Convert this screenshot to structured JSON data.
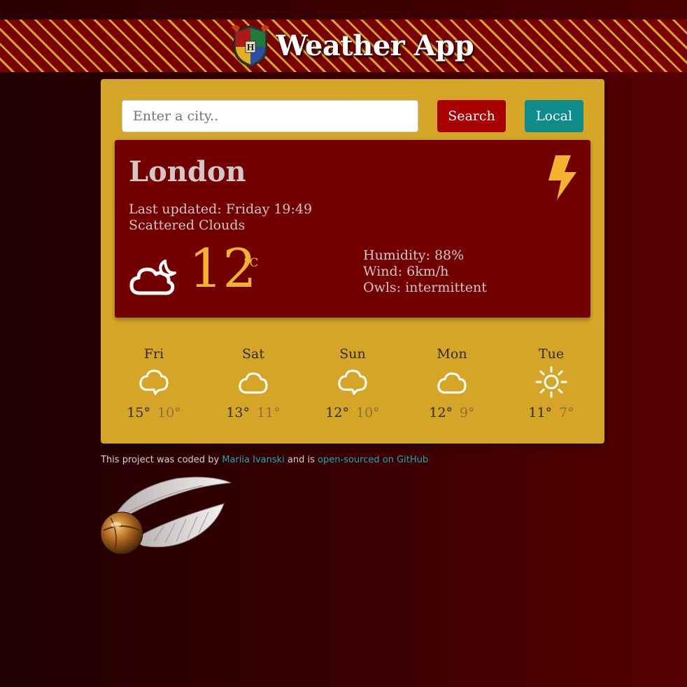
{
  "header": {
    "title": "Weather App"
  },
  "search": {
    "placeholder": "Enter a city..",
    "value": "",
    "search_label": "Search",
    "local_label": "Local"
  },
  "current": {
    "city": "London",
    "updated": "Last updated: Friday 19:49",
    "description": "Scattered Clouds",
    "temperature": "12",
    "unit": "°C",
    "humidity": "Humidity: 88%",
    "wind": "Wind: 6km/h",
    "owls": "Owls: intermittent",
    "icon": "cloud-moon-icon",
    "alert_icon": "lightning-bolt-icon"
  },
  "forecast": [
    {
      "day": "Fri",
      "max": "15°",
      "min": "10°",
      "icon": "cloud-icon"
    },
    {
      "day": "Sat",
      "max": "13°",
      "min": "11°",
      "icon": "cloud-icon"
    },
    {
      "day": "Sun",
      "max": "12°",
      "min": "10°",
      "icon": "cloud-icon"
    },
    {
      "day": "Mon",
      "max": "12°",
      "min": "9°",
      "icon": "cloud-icon"
    },
    {
      "day": "Tue",
      "max": "11°",
      "min": "7°",
      "icon": "sun-icon"
    }
  ],
  "footer": {
    "prefix": "This project was coded by",
    "author": "Mariia Ivanski",
    "middle": "and is",
    "repo_link": "open-sourced on GitHub"
  },
  "colors": {
    "banner_red": "#7a0000",
    "banner_gold": "#d4a526",
    "card_gold": "#d4a526",
    "panel_red": "#730000",
    "search_button": "#a80000",
    "local_button": "#0e8c8c",
    "temperature": "#f2b42f",
    "link": "#20a7b4"
  }
}
